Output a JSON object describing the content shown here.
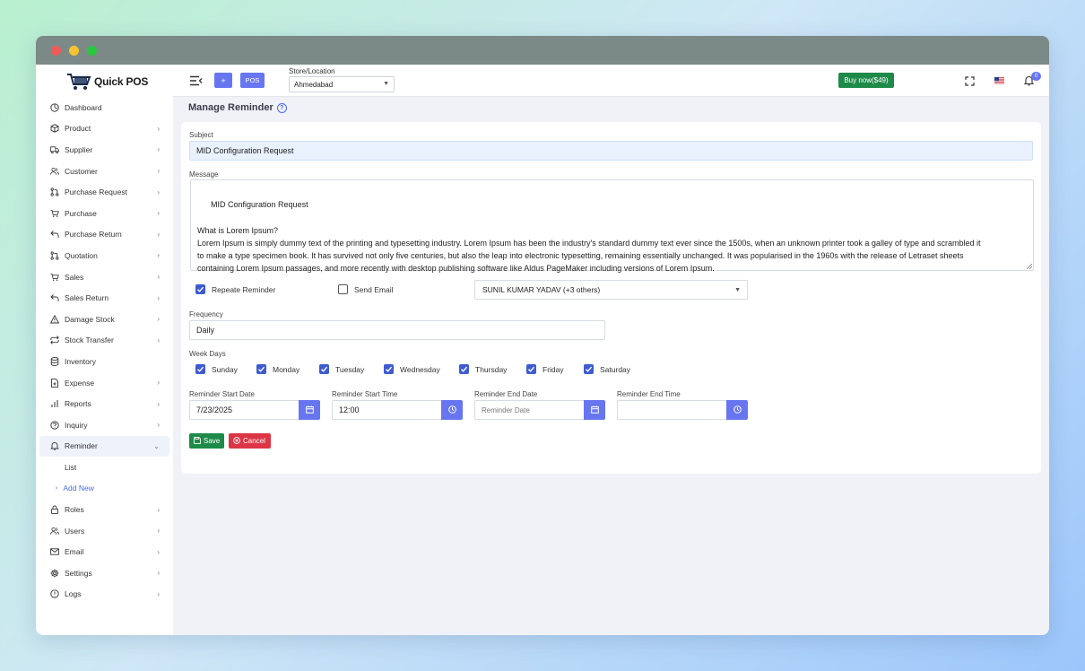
{
  "app": {
    "name": "Quick POS"
  },
  "header": {
    "plus_label": "+",
    "pos_label": "POS",
    "store_label": "Store/Location",
    "store_value": "Ahmedabad",
    "buy_label": "Buy now($49)",
    "notification_count": "0"
  },
  "sidebar": {
    "items": [
      {
        "label": "Dashboard",
        "icon": "dashboard-icon",
        "chevron": ""
      },
      {
        "label": "Product",
        "icon": "box-icon",
        "chevron": "›"
      },
      {
        "label": "Supplier",
        "icon": "truck-icon",
        "chevron": "›"
      },
      {
        "label": "Customer",
        "icon": "users-icon",
        "chevron": "›"
      },
      {
        "label": "Purchase Request",
        "icon": "git-request-icon",
        "chevron": "›"
      },
      {
        "label": "Purchase",
        "icon": "cart-icon",
        "chevron": "›"
      },
      {
        "label": "Purchase Return",
        "icon": "return-icon",
        "chevron": "›"
      },
      {
        "label": "Quotation",
        "icon": "git-request-icon",
        "chevron": "›"
      },
      {
        "label": "Sales",
        "icon": "cart-icon",
        "chevron": "›"
      },
      {
        "label": "Sales Return",
        "icon": "return-icon",
        "chevron": "›"
      },
      {
        "label": "Damage Stock",
        "icon": "warning-icon",
        "chevron": "›"
      },
      {
        "label": "Stock Transfer",
        "icon": "transfer-icon",
        "chevron": "›"
      },
      {
        "label": "Inventory",
        "icon": "database-icon",
        "chevron": ""
      },
      {
        "label": "Expense",
        "icon": "file-plus-icon",
        "chevron": "›"
      },
      {
        "label": "Reports",
        "icon": "bar-chart-icon",
        "chevron": "›"
      },
      {
        "label": "Inquiry",
        "icon": "help-circle-icon",
        "chevron": "›"
      },
      {
        "label": "Reminder",
        "icon": "bell-icon",
        "chevron": "⌄"
      }
    ],
    "reminder_sub": [
      {
        "label": "List"
      },
      {
        "label": "Add New"
      }
    ],
    "items_after": [
      {
        "label": "Roles",
        "icon": "lock-icon",
        "chevron": "›"
      },
      {
        "label": "Users",
        "icon": "users-icon",
        "chevron": "›"
      },
      {
        "label": "Email",
        "icon": "mail-icon",
        "chevron": "›"
      },
      {
        "label": "Settings",
        "icon": "gear-icon",
        "chevron": "›"
      },
      {
        "label": "Logs",
        "icon": "info-icon",
        "chevron": "›"
      }
    ]
  },
  "page": {
    "title": "Manage Reminder",
    "subject_label": "Subject",
    "subject_value": "MID Configuration Request",
    "message_label": "Message",
    "message_value": "MID Configuration Request\n\nWhat is Lorem Ipsum?\nLorem Ipsum is simply dummy text of the printing and typesetting industry. Lorem Ipsum has been the industry's standard dummy text ever since the 1500s, when an unknown printer took a galley of type and scrambled it\nto make a type specimen book. It has survived not only five centuries, but also the leap into electronic typesetting, remaining essentially unchanged. It was popularised in the 1960s with the release of Letraset sheets\ncontaining Lorem Ipsum passages, and more recently with desktop publishing software like Aldus PageMaker including versions of Lorem Ipsum.",
    "repeat_label": "Repeate Reminder",
    "repeat_checked": true,
    "send_email_label": "Send Email",
    "send_email_checked": false,
    "recipients_value": "SUNIL KUMAR YADAV (+3 others)",
    "frequency_label": "Frequency",
    "frequency_value": "Daily",
    "weekdays_label": "Week Days",
    "weekdays": [
      {
        "label": "Sunday",
        "checked": true
      },
      {
        "label": "Monday",
        "checked": true
      },
      {
        "label": "Tuesday",
        "checked": true
      },
      {
        "label": "Wednesday",
        "checked": true
      },
      {
        "label": "Thursday",
        "checked": true
      },
      {
        "label": "Friday",
        "checked": true
      },
      {
        "label": "Saturday",
        "checked": true
      }
    ],
    "start_date_label": "Reminder Start Date",
    "start_date_value": "7/23/2025",
    "start_time_label": "Reminder Start Time",
    "start_time_value": "12:00",
    "end_date_label": "Reminder End Date",
    "end_date_placeholder": "Reminder Date",
    "end_time_label": "Reminder End Time",
    "end_time_value": "",
    "save_label": "Save",
    "cancel_label": "Cancel"
  },
  "colors": {
    "accent": "#6776f0",
    "checkbox": "#3f5bd1",
    "success": "#1e8a4a",
    "danger": "#dc3545"
  }
}
